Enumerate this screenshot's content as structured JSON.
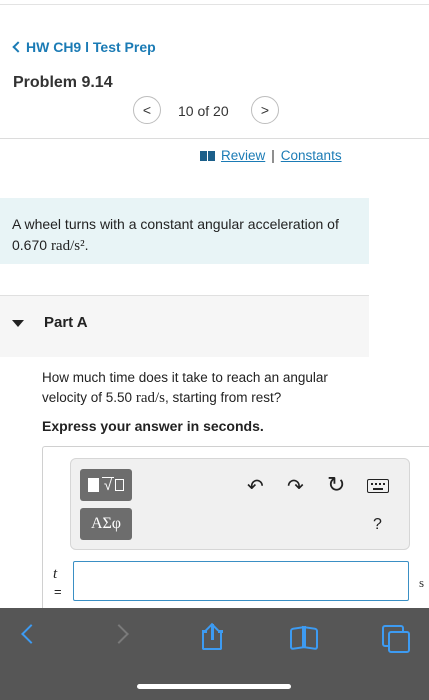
{
  "header": {
    "back_label": "HW CH9 l Test Prep",
    "problem_title": "Problem 9.14"
  },
  "pager": {
    "prev_symbol": "<",
    "count": "10 of 20",
    "next_symbol": ">"
  },
  "links": {
    "review": "Review",
    "separator": "|",
    "constants": "Constants"
  },
  "problem": {
    "text": "A wheel turns with a constant angular acceleration of",
    "value": "0.670",
    "unit": "rad/s²",
    "end": "."
  },
  "part": {
    "title": "Part A",
    "question_prefix": "How much time does it take to reach an angular velocity of 5.50",
    "question_unit": "rad/s",
    "question_suffix": ", starting from rest?",
    "instruction": "Express your answer in seconds."
  },
  "toolbar": {
    "templates_icon": "templates-icon",
    "symbols_label": "ΑΣφ",
    "undo": "↶",
    "redo": "↷",
    "reset": "↻",
    "help": "?"
  },
  "answer": {
    "variable": "t",
    "equals": "=",
    "value": "",
    "unit": "s"
  },
  "browser": {
    "accent": "#3d9bf2",
    "bar_color": "#565656"
  }
}
